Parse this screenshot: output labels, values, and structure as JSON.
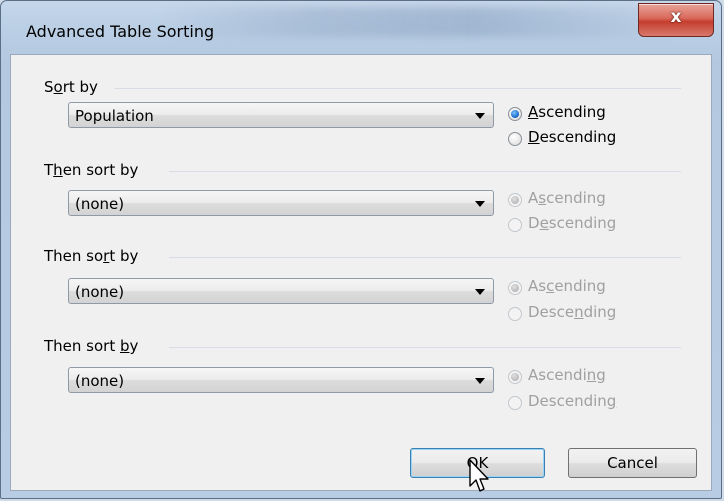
{
  "window": {
    "title": "Advanced Table Sorting",
    "close_glyph": "x"
  },
  "groups": [
    {
      "label_pre": "S",
      "label_accel": "o",
      "label_post": "rt by",
      "selected": "Population",
      "ascending": {
        "pre": "",
        "accel": "A",
        "post": "scending"
      },
      "descending": {
        "pre": "",
        "accel": "D",
        "post": "escending"
      },
      "checked": "ascending",
      "enabled": true
    },
    {
      "label_pre": "T",
      "label_accel": "h",
      "label_post": "en sort by",
      "selected": "(none)",
      "ascending": {
        "pre": "A",
        "accel": "s",
        "post": "cending"
      },
      "descending": {
        "pre": "D",
        "accel": "e",
        "post": "scending"
      },
      "checked": "ascending",
      "enabled": false
    },
    {
      "label_pre": "Then so",
      "label_accel": "r",
      "label_post": "t by",
      "selected": "(none)",
      "ascending": {
        "pre": "As",
        "accel": "c",
        "post": "ending"
      },
      "descending": {
        "pre": "Desce",
        "accel": "n",
        "post": "ding"
      },
      "checked": "ascending",
      "enabled": false
    },
    {
      "label_pre": "Then sort ",
      "label_accel": "b",
      "label_post": "y",
      "selected": "(none)",
      "ascending": {
        "pre": "Ascendi",
        "accel": "n",
        "post": "g"
      },
      "descending": {
        "pre": "Descendin",
        "accel": "g",
        "post": ""
      },
      "checked": "ascending",
      "enabled": false
    }
  ],
  "buttons": {
    "ok": "OK",
    "cancel": "Cancel"
  }
}
